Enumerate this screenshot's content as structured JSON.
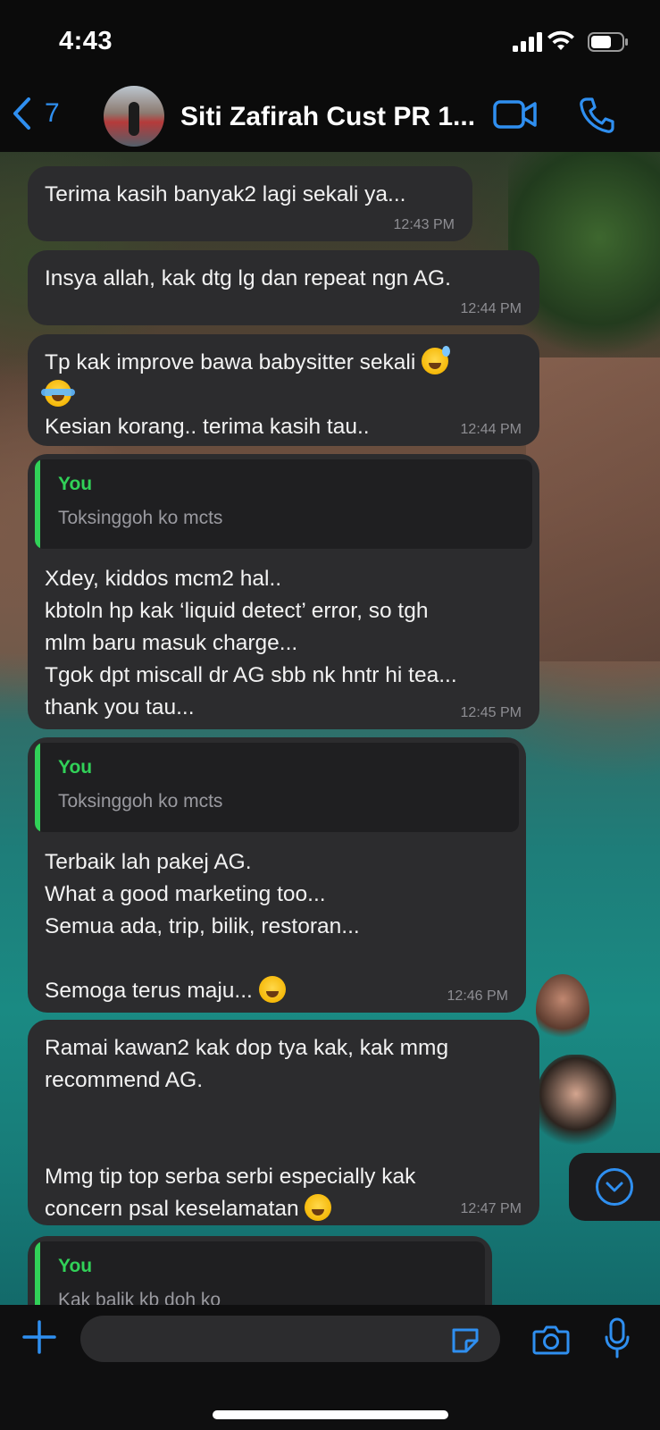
{
  "status_bar": {
    "time": "4:43"
  },
  "header": {
    "back_count": "7",
    "chat_title": "Siti Zafirah Cust PR 1..."
  },
  "messages": [
    {
      "text": "Terima kasih banyak2 lagi sekali ya...",
      "time": "12:43 PM"
    },
    {
      "text": "Insya allah, kak dtg lg dan repeat ngn AG.",
      "time": "12:44 PM"
    },
    {
      "text_line1": "Tp kak improve bawa babysitter sekali",
      "text_line2": "Kesian korang.. terima kasih tau..",
      "time": "12:44 PM"
    },
    {
      "quote_name": "You",
      "quote_text": "Toksinggoh ko mcts",
      "text": "Xdey, kiddos mcm2 hal..\nkbtoln hp kak ‘liquid detect’ error, so tgh\nmlm baru masuk charge...\nTgok dpt miscall dr AG sbb nk hntr hi tea...\nthank you tau...",
      "time": "12:45 PM"
    },
    {
      "quote_name": "You",
      "quote_text": "Toksinggoh ko mcts",
      "text": "Terbaik lah pakej AG.\nWhat a good marketing too...\nSemua ada, trip, bilik, restoran...\n",
      "text_last": "Semoga terus maju...",
      "time": "12:46 PM"
    },
    {
      "text": "Ramai kawan2 kak dop tya kak, kak mmg\nrecommend AG.\n\n",
      "text_last1": "Mmg tip top serba serbi especially kak",
      "text_last2": "concern psal keselamatan",
      "time": "12:47 PM"
    },
    {
      "quote_name": "You",
      "quote_text": "Kak balik kb doh ko"
    }
  ],
  "colors": {
    "accent": "#2f8ff0",
    "bubble": "#2c2c2e",
    "quote_bar": "#31d158"
  }
}
